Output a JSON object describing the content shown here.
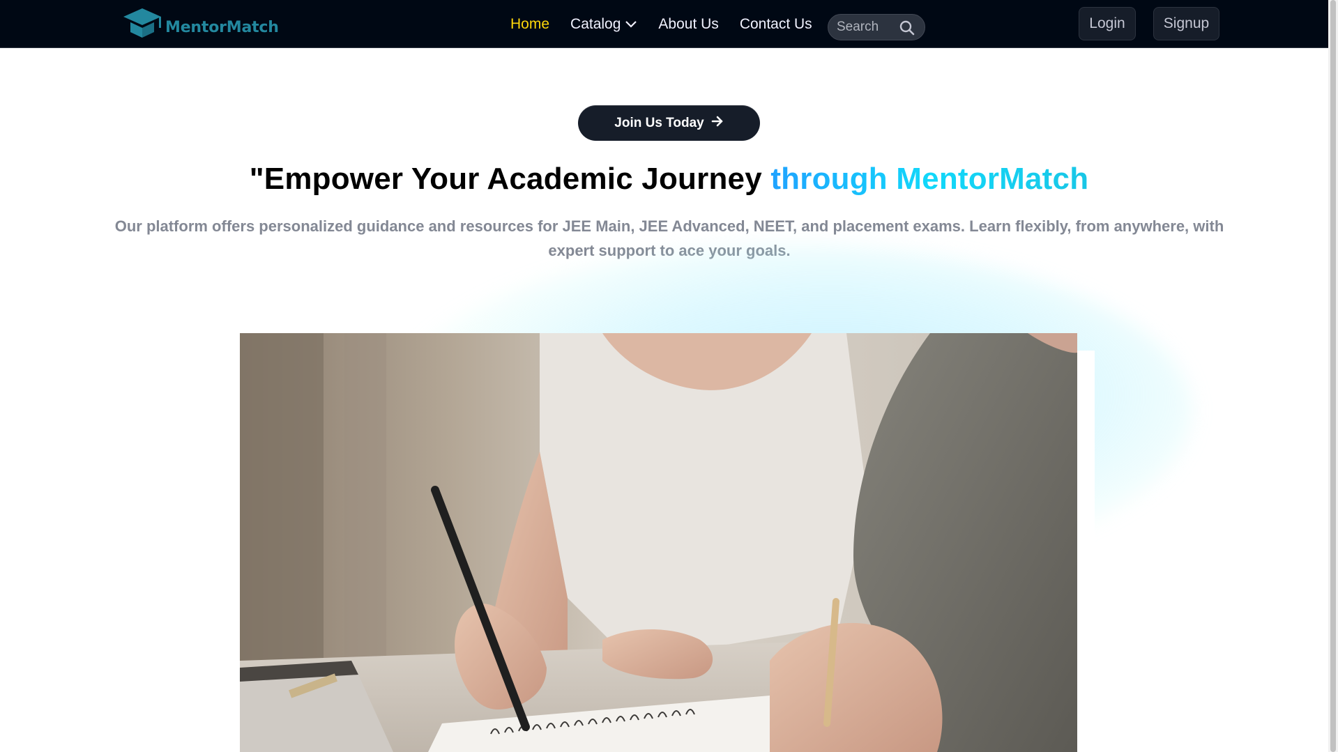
{
  "brand": {
    "name": "MentorMatch",
    "logo_icon": "graduation-cap-icon",
    "logo_color": "#23889f"
  },
  "nav": {
    "links": [
      {
        "label": "Home",
        "active": true
      },
      {
        "label": "Catalog",
        "has_dropdown": true
      },
      {
        "label": "About Us"
      },
      {
        "label": "Contact Us"
      }
    ],
    "active_color": "#ffd60a",
    "search": {
      "placeholder": "Search",
      "value": ""
    },
    "login_label": "Login",
    "signup_label": "Signup"
  },
  "hero": {
    "cta_label": "Join Us Today",
    "cta_icon": "arrow-right-icon",
    "title_plain": "\"Empower Your Academic Journey ",
    "title_highlight": "through MentorMatch",
    "subtitle": "Our platform offers personalized guidance and resources for JEE Main, JEE Advanced, NEET, and placement exams. Learn flexibly, from anywhere, with expert support to ace your goals.",
    "media": "student-writing-in-notebook-image"
  },
  "colors": {
    "navbar_bg": "#000814",
    "cta_bg": "#161d29",
    "subtitle": "#838894",
    "highlight_start": "#1fa2ff",
    "highlight_end": "#12d8fa"
  }
}
